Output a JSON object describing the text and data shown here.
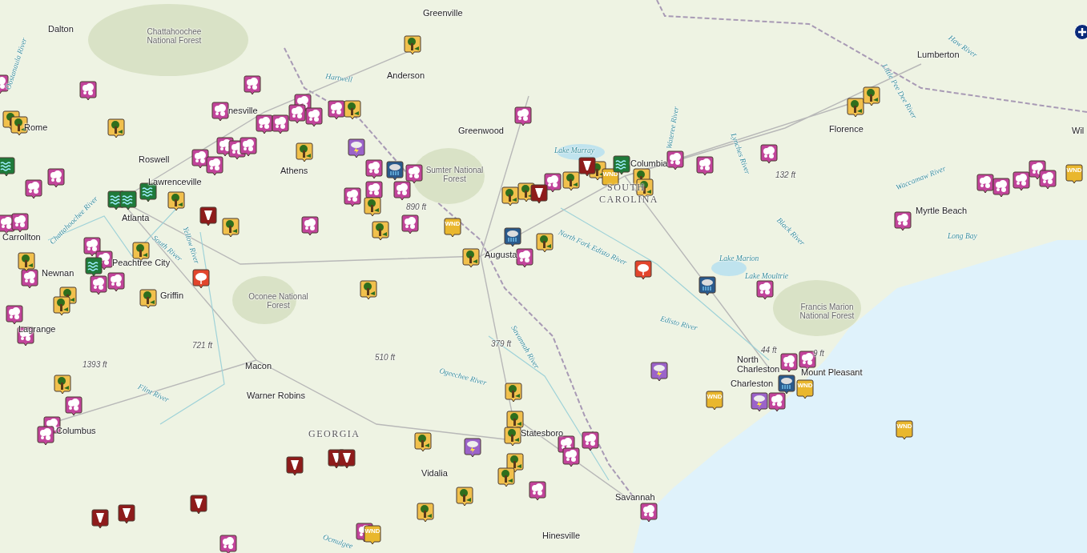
{
  "map": {
    "labels": [
      {
        "text": "Greenville",
        "kind": "city"
      },
      {
        "text": "Dalton",
        "kind": "city"
      },
      {
        "text": "Chattahoochee National Forest",
        "kind": "forest"
      },
      {
        "text": "Anderson",
        "kind": "city"
      },
      {
        "text": "Hartwell",
        "kind": "water"
      },
      {
        "text": "Lumberton",
        "kind": "city"
      },
      {
        "text": "Haw River",
        "kind": "water"
      },
      {
        "text": "Little Pee Dee River",
        "kind": "water"
      },
      {
        "text": "Greenwood",
        "kind": "city"
      },
      {
        "text": "Florence",
        "kind": "city"
      },
      {
        "text": "Wil",
        "kind": "city"
      },
      {
        "text": "Lake Murray",
        "kind": "water"
      },
      {
        "text": "Columbia",
        "kind": "city"
      },
      {
        "text": "SOUTH",
        "kind": "state"
      },
      {
        "text": "CAROLINA",
        "kind": "state"
      },
      {
        "text": "Rome",
        "kind": "city"
      },
      {
        "text": "nesville",
        "kind": "city"
      },
      {
        "text": "Roswell",
        "kind": "city"
      },
      {
        "text": "Athens",
        "kind": "city"
      },
      {
        "text": "Lawrenceville",
        "kind": "city"
      },
      {
        "text": "Sumter National Forest",
        "kind": "forest"
      },
      {
        "text": "890 ft",
        "kind": "elevation"
      },
      {
        "text": "132 ft",
        "kind": "elevation"
      },
      {
        "text": "Atlanta",
        "kind": "city"
      },
      {
        "text": "Carrollton",
        "kind": "city"
      },
      {
        "text": "Chattahoochee River",
        "kind": "water"
      },
      {
        "text": "South River",
        "kind": "water"
      },
      {
        "text": "Yellow River",
        "kind": "water"
      },
      {
        "text": "Oostanaula River",
        "kind": "water"
      },
      {
        "text": "North Fork Edisto River",
        "kind": "water"
      },
      {
        "text": "Myrtle Beach",
        "kind": "city"
      },
      {
        "text": "Long Bay",
        "kind": "water"
      },
      {
        "text": "Black River",
        "kind": "water"
      },
      {
        "text": "Waccamaw River",
        "kind": "water"
      },
      {
        "text": "Wateree River",
        "kind": "water"
      },
      {
        "text": "Lynches River",
        "kind": "water"
      },
      {
        "text": "Augusta",
        "kind": "city"
      },
      {
        "text": "Newnan",
        "kind": "city"
      },
      {
        "text": "Peachtree City",
        "kind": "city"
      },
      {
        "text": "Griffin",
        "kind": "city"
      },
      {
        "text": "Oconee National Forest",
        "kind": "forest"
      },
      {
        "text": "Lake Marion",
        "kind": "water"
      },
      {
        "text": "Lake Moultrie",
        "kind": "water"
      },
      {
        "text": "Francis Marion National Forest",
        "kind": "forest"
      },
      {
        "text": "Edisto River",
        "kind": "water"
      },
      {
        "text": "Lagrange",
        "kind": "city"
      },
      {
        "text": "721 ft",
        "kind": "elevation"
      },
      {
        "text": "1393 ft",
        "kind": "elevation"
      },
      {
        "text": "510 ft",
        "kind": "elevation"
      },
      {
        "text": "379 ft",
        "kind": "elevation"
      },
      {
        "text": "44 ft",
        "kind": "elevation"
      },
      {
        "text": "9 ft",
        "kind": "elevation"
      },
      {
        "text": "North Charleston",
        "kind": "city"
      },
      {
        "text": "Charleston",
        "kind": "city"
      },
      {
        "text": "Mount Pleasant",
        "kind": "city"
      },
      {
        "text": "Savannah River",
        "kind": "water"
      },
      {
        "text": "Ogeechee River",
        "kind": "water"
      },
      {
        "text": "Macon",
        "kind": "city"
      },
      {
        "text": "Warner Robins",
        "kind": "city"
      },
      {
        "text": "Flint River",
        "kind": "water"
      },
      {
        "text": "Columbus",
        "kind": "city"
      },
      {
        "text": "GEORGIA",
        "kind": "state"
      },
      {
        "text": "Statesboro",
        "kind": "city"
      },
      {
        "text": "Vidalia",
        "kind": "city"
      },
      {
        "text": "Savannah",
        "kind": "city"
      },
      {
        "text": "Hinesville",
        "kind": "city"
      },
      {
        "text": "Ocmulgee",
        "kind": "water"
      }
    ],
    "markers": [
      {
        "kind": "hail"
      },
      {
        "kind": "hail"
      },
      {
        "kind": "hail"
      },
      {
        "kind": "hail"
      },
      {
        "kind": "hail"
      },
      {
        "kind": "hail"
      },
      {
        "kind": "hail"
      },
      {
        "kind": "hail"
      },
      {
        "kind": "hail"
      },
      {
        "kind": "hail"
      },
      {
        "kind": "hail"
      },
      {
        "kind": "hail"
      },
      {
        "kind": "hail"
      },
      {
        "kind": "hail"
      },
      {
        "kind": "hail"
      },
      {
        "kind": "hail"
      },
      {
        "kind": "hail"
      },
      {
        "kind": "hail"
      },
      {
        "kind": "hail"
      },
      {
        "kind": "hail"
      },
      {
        "kind": "hail"
      },
      {
        "kind": "hail"
      },
      {
        "kind": "hail"
      },
      {
        "kind": "hail"
      },
      {
        "kind": "hail"
      },
      {
        "kind": "hail"
      },
      {
        "kind": "hail"
      },
      {
        "kind": "hail"
      },
      {
        "kind": "hail"
      },
      {
        "kind": "hail"
      },
      {
        "kind": "hail"
      },
      {
        "kind": "hail"
      },
      {
        "kind": "hail"
      },
      {
        "kind": "hail"
      },
      {
        "kind": "hail"
      },
      {
        "kind": "hail"
      },
      {
        "kind": "hail"
      },
      {
        "kind": "hail"
      },
      {
        "kind": "hail"
      },
      {
        "kind": "hail"
      },
      {
        "kind": "hail"
      },
      {
        "kind": "hail"
      },
      {
        "kind": "hail"
      },
      {
        "kind": "hail"
      },
      {
        "kind": "hail"
      },
      {
        "kind": "hail"
      },
      {
        "kind": "hail"
      },
      {
        "kind": "hail"
      },
      {
        "kind": "hail"
      },
      {
        "kind": "hail"
      },
      {
        "kind": "hail"
      },
      {
        "kind": "hail"
      },
      {
        "kind": "hail"
      },
      {
        "kind": "hail"
      },
      {
        "kind": "hail"
      },
      {
        "kind": "hail"
      },
      {
        "kind": "hail"
      },
      {
        "kind": "hail"
      },
      {
        "kind": "hail"
      },
      {
        "kind": "tree"
      },
      {
        "kind": "tree"
      },
      {
        "kind": "tree"
      },
      {
        "kind": "tree"
      },
      {
        "kind": "tree"
      },
      {
        "kind": "tree"
      },
      {
        "kind": "tree"
      },
      {
        "kind": "tree"
      },
      {
        "kind": "tree"
      },
      {
        "kind": "tree"
      },
      {
        "kind": "tree"
      },
      {
        "kind": "tree"
      },
      {
        "kind": "tree"
      },
      {
        "kind": "tree"
      },
      {
        "kind": "tree"
      },
      {
        "kind": "tree"
      },
      {
        "kind": "tree"
      },
      {
        "kind": "tree"
      },
      {
        "kind": "tree"
      },
      {
        "kind": "tree"
      },
      {
        "kind": "tree"
      },
      {
        "kind": "tree"
      },
      {
        "kind": "tree"
      },
      {
        "kind": "tree"
      },
      {
        "kind": "tree"
      },
      {
        "kind": "tree"
      },
      {
        "kind": "tree"
      },
      {
        "kind": "tree"
      },
      {
        "kind": "tree"
      },
      {
        "kind": "tree"
      },
      {
        "kind": "tree"
      },
      {
        "kind": "tree"
      },
      {
        "kind": "tree"
      },
      {
        "kind": "tree"
      },
      {
        "kind": "tree"
      },
      {
        "kind": "wind",
        "label": "WND"
      },
      {
        "kind": "wind",
        "label": "WND"
      },
      {
        "kind": "wind",
        "label": "WND"
      },
      {
        "kind": "wind",
        "label": "WND"
      },
      {
        "kind": "wind",
        "label": "WND"
      },
      {
        "kind": "wind",
        "label": "WND"
      },
      {
        "kind": "wind",
        "label": "WND"
      },
      {
        "kind": "tornado"
      },
      {
        "kind": "tornado"
      },
      {
        "kind": "tornado"
      },
      {
        "kind": "tornado"
      },
      {
        "kind": "tornado"
      },
      {
        "kind": "tornado"
      },
      {
        "kind": "tornado"
      },
      {
        "kind": "tornado"
      },
      {
        "kind": "tornado"
      },
      {
        "kind": "flood"
      },
      {
        "kind": "flood"
      },
      {
        "kind": "flood"
      },
      {
        "kind": "flood"
      },
      {
        "kind": "flood"
      },
      {
        "kind": "flood"
      },
      {
        "kind": "rain"
      },
      {
        "kind": "rain"
      },
      {
        "kind": "rain"
      },
      {
        "kind": "rain"
      },
      {
        "kind": "lightning"
      },
      {
        "kind": "lightning"
      },
      {
        "kind": "lightning"
      },
      {
        "kind": "lightning"
      },
      {
        "kind": "storm"
      },
      {
        "kind": "storm"
      }
    ]
  }
}
